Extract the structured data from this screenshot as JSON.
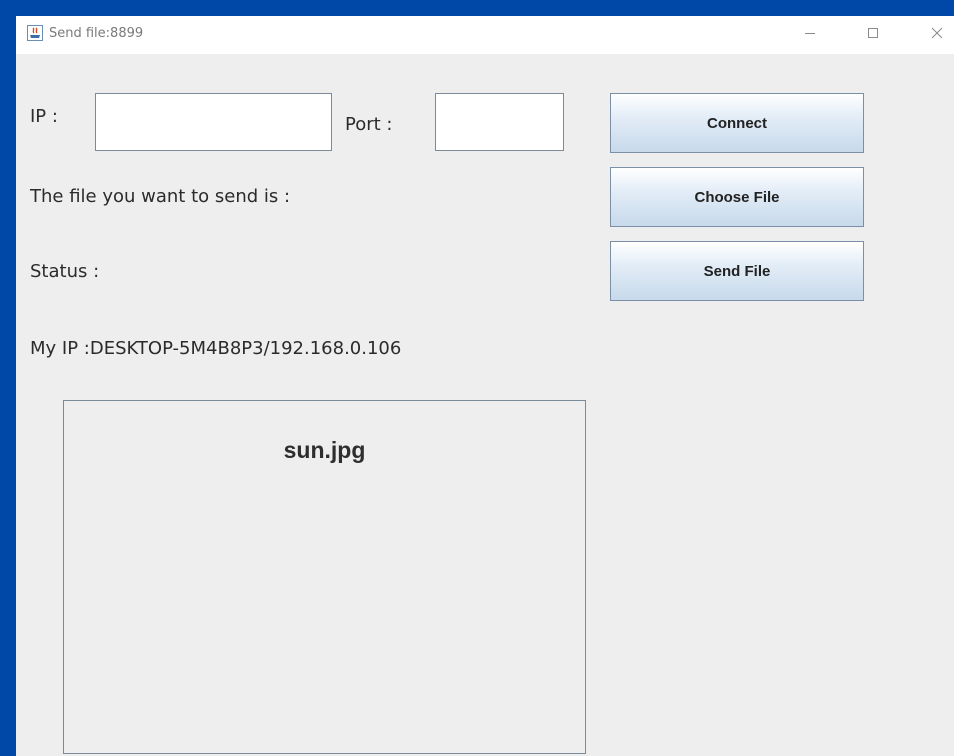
{
  "window": {
    "title": "Send file:8899"
  },
  "form": {
    "ip_label": "IP :",
    "ip_value": "",
    "port_label": "Port :",
    "port_value": "",
    "file_label": "The file you want to send is :",
    "status_label": "Status :",
    "my_ip_label": "My IP :DESKTOP-5M4B8P3/192.168.0.106"
  },
  "buttons": {
    "connect": "Connect",
    "choose_file": "Choose File",
    "send_file": "Send File"
  },
  "preview": {
    "file_name": "sun.jpg"
  },
  "icons": {
    "app": "java-app-icon",
    "minimize": "minimize-icon",
    "maximize": "maximize-icon",
    "close": "close-icon"
  },
  "colors": {
    "desktop": "#0048a8",
    "window_bg": "#eeeeee",
    "button_top": "#ffffff",
    "button_bottom": "#c7d9eb"
  }
}
